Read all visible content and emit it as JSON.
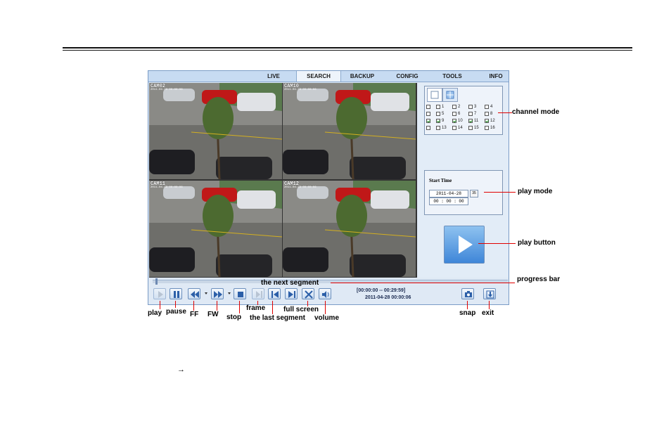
{
  "tabs": [
    "LIVE",
    "SEARCH",
    "BACKUP",
    "CONFIG",
    "TOOLS",
    "INFO"
  ],
  "active_tab": "SEARCH",
  "cameras": [
    {
      "label": "CAM02",
      "ts": "2011-04-28 00:00:06"
    },
    {
      "label": "CAM10",
      "ts": "2011-04-28 00:00:06"
    },
    {
      "label": "CAM11",
      "ts": "2011-04-28 00:00:06"
    },
    {
      "label": "CAM12",
      "ts": "2011-04-28 00:00:06"
    }
  ],
  "channels": [
    [
      {
        "n": "",
        "on": false
      },
      {
        "n": "1",
        "on": false
      },
      {
        "n": "2",
        "on": false
      },
      {
        "n": "3",
        "on": false
      },
      {
        "n": "4",
        "on": false
      }
    ],
    [
      {
        "n": "",
        "on": false
      },
      {
        "n": "5",
        "on": false
      },
      {
        "n": "6",
        "on": false
      },
      {
        "n": "7",
        "on": false
      },
      {
        "n": "8",
        "on": false
      }
    ],
    [
      {
        "n": "",
        "on": true
      },
      {
        "n": "9",
        "on": true
      },
      {
        "n": "10",
        "on": true
      },
      {
        "n": "11",
        "on": true
      },
      {
        "n": "12",
        "on": true
      }
    ],
    [
      {
        "n": "",
        "on": false
      },
      {
        "n": "13",
        "on": false
      },
      {
        "n": "14",
        "on": false
      },
      {
        "n": "15",
        "on": false
      },
      {
        "n": "16",
        "on": false
      }
    ]
  ],
  "start_time": {
    "title": "Start Time",
    "date": "2011-04-28",
    "calendar_btn": "35",
    "time": "00 : 00 : 00"
  },
  "playback": {
    "range": "[00:00:00 -- 00:29:59]",
    "current": "2011-04-28 00:00:06"
  },
  "annotations": {
    "channel_mode": "channel mode",
    "play_mode": "play mode",
    "play_button": "play button",
    "progress_bar": "progress bar",
    "next_segment": "the next segment",
    "play": "play",
    "pause": "pause",
    "ff": "FF",
    "fw": "FW",
    "stop": "stop",
    "frame": "frame",
    "last_segment": "the last segment",
    "full_screen": "full screen",
    "volume": "volume",
    "snap": "snap",
    "exit": "exit"
  },
  "footer_arrow": "→",
  "colors": {
    "accent": "#3f86d8",
    "callout": "#e00000",
    "panel": "#dfe9f5"
  }
}
